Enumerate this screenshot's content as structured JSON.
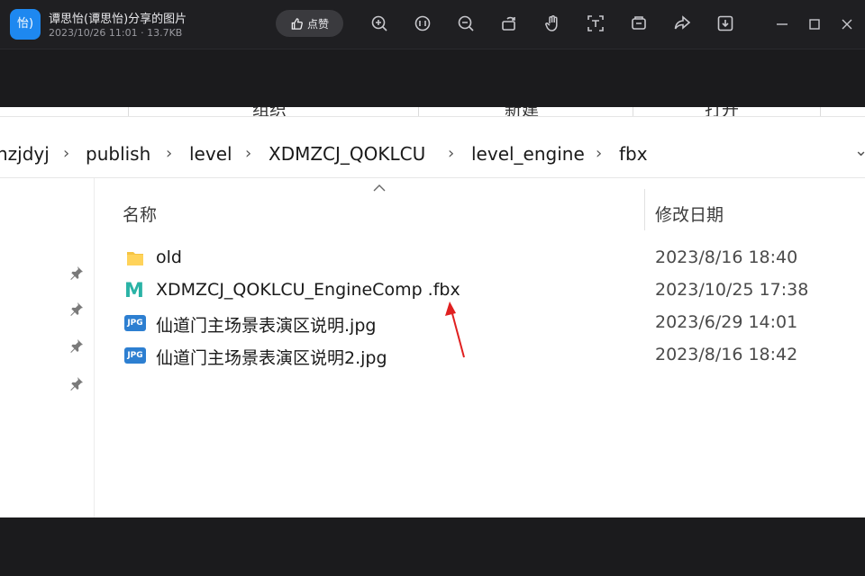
{
  "viewer": {
    "app_icon_text": "怡)",
    "title": "谭思怡(谭思怡)分享的图片",
    "meta": "2023/10/26 11:01 · 13.7KB",
    "like_label": "点赞",
    "tools": [
      "zoom-in-icon",
      "actual-size-icon",
      "zoom-out-icon",
      "rotate-icon",
      "hand-icon",
      "text-extract-icon",
      "screenshot-icon",
      "share-icon",
      "download-icon"
    ],
    "window_controls": [
      "minimize-icon",
      "maximize-icon",
      "close-icon"
    ]
  },
  "explorer": {
    "ribbon_cut": [
      "组织",
      "新建",
      "打开"
    ],
    "breadcrumb": [
      "nzjdyj",
      "publish",
      "level",
      "XDMZCJ_QOKLCU",
      "level_engine",
      "fbx"
    ],
    "columns": {
      "name": "名称",
      "date": "修改日期"
    },
    "files": [
      {
        "name": "old",
        "date": "2023/8/16 18:40",
        "type": "folder"
      },
      {
        "name": "XDMZCJ_QOKLCU_EngineComp .fbx",
        "date": "2023/10/25 17:38",
        "type": "maya"
      },
      {
        "name": "仙道门主场景表演区说明.jpg",
        "date": "2023/6/29 14:01",
        "type": "jpg"
      },
      {
        "name": "仙道门主场景表演区说明2.jpg",
        "date": "2023/8/16 18:42",
        "type": "jpg"
      }
    ],
    "jpg_badge": "JPG",
    "maya_badge": "M"
  },
  "colors": {
    "accent": "#1e88f0",
    "annotation_arrow": "#e02020"
  }
}
